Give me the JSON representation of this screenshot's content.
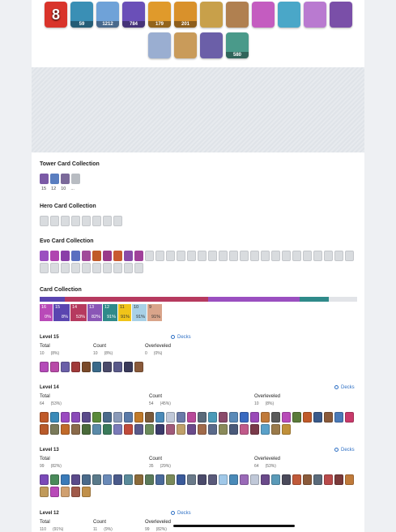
{
  "badges": [
    {
      "value": "8",
      "color": "#d9342b"
    },
    {
      "value": "59",
      "color": "#3a8fb5"
    },
    {
      "value": "1212",
      "color": "#6fa2d8"
    },
    {
      "value": "784",
      "color": "#6a4fb8"
    },
    {
      "value": "179",
      "color": "#e09a2b"
    },
    {
      "value": "201",
      "color": "#d9912b"
    },
    {
      "value": "",
      "color": "#c8a04a"
    },
    {
      "value": "",
      "color": "#b08050"
    },
    {
      "value": "",
      "color": "#c45cc0"
    },
    {
      "value": "",
      "color": "#4aa7c8"
    },
    {
      "value": "",
      "color": "#b97ad0"
    },
    {
      "value": "",
      "color": "#7a4fa8"
    },
    {
      "value": "",
      "color": "#9aaed1"
    },
    {
      "value": "",
      "color": "#c99b5a"
    },
    {
      "value": "",
      "color": "#6b5fa8"
    },
    {
      "value": "580",
      "color": "#4a9a8a"
    }
  ],
  "tower": {
    "title": "Tower Card Collection",
    "counts": [
      "15",
      "12",
      "10",
      "..."
    ],
    "colors": [
      "#7b5aa6",
      "#5a7ec0",
      "#7b6a9a",
      "#b8bcc2"
    ]
  },
  "hero": {
    "title": "Hero Card Collection",
    "count": 8
  },
  "evo": {
    "title": "Evo Card Collection",
    "colors": [
      "#9b4fc0",
      "#b045b0",
      "#8a3fa8",
      "#5a6fc0",
      "#a04a9a",
      "#c05a2a",
      "#9a3a8a",
      "#c85a30",
      "#8a4aa8",
      "#a0409a"
    ],
    "grey_count": 30
  },
  "card_collection": {
    "title": "Card Collection",
    "bar": [
      {
        "color": "#5a45b0",
        "pct": 8
      },
      {
        "color": "#b63a5f",
        "pct": 45
      },
      {
        "color": "#9a4fc0",
        "pct": 29
      },
      {
        "color": "#2f8a8a",
        "pct": 9
      },
      {
        "color": "#e2e4e8",
        "pct": 9
      }
    ],
    "levels": [
      {
        "count": "16",
        "pct": "0%",
        "color": "#b94ab8",
        "w": 16
      },
      {
        "count": "15",
        "pct": "8%",
        "color": "#5a45b0",
        "w": 20
      },
      {
        "count": "14",
        "pct": "53%",
        "color": "#b63a5f",
        "w": 20
      },
      {
        "count": "13",
        "pct": "82%",
        "color": "#8a56b6",
        "w": 18
      },
      {
        "count": "12",
        "pct": "91%",
        "color": "#2f8a8a",
        "w": 18
      },
      {
        "count": "11",
        "pct": "91%",
        "color": "#f0c419",
        "w": 16
      },
      {
        "count": "10",
        "pct": "91%",
        "color": "#a8d0e6",
        "w": 18
      },
      {
        "count": "9",
        "pct": "91%",
        "color": "#d9a48a",
        "w": 18
      }
    ]
  },
  "levels": [
    {
      "title": "Level 15",
      "total_label": "Total",
      "count_label": "Count",
      "over_label": "Overleveled",
      "total": "10",
      "total_pct": "(8%)",
      "count": "10",
      "count_pct": "(8%)",
      "over": "0",
      "over_pct": "(0%)",
      "decks": "Decks",
      "cards": [
        "#b44ab8",
        "#b84aa8",
        "#6b5fa8",
        "#a03a3a",
        "#7a4a2a",
        "#3a6a8a",
        "#4a4a6a",
        "#5a5a8a",
        "#3a3a5a",
        "#8a5a3a"
      ]
    },
    {
      "title": "Level 14",
      "total_label": "Total",
      "count_label": "Count",
      "over_label": "Overleveled",
      "total": "64",
      "total_pct": "(53%)",
      "count": "54",
      "count_pct": "(45%)",
      "over": "10",
      "over_pct": "(8%)",
      "decks": "Decks",
      "cards": [
        "#c05a2a",
        "#3a8ab8",
        "#9a4ac0",
        "#8a4ab8",
        "#5a4a8a",
        "#5a8a3a",
        "#4a6a8a",
        "#8a9ab8",
        "#5a7aa8",
        "#c07a2a",
        "#7a5a3a",
        "#4a8ab8",
        "#c0c8d8",
        "#6a7aa8",
        "#b84a9a",
        "#5a6a7a",
        "#4a9ab8",
        "#8a4a6a",
        "#5a8ab8",
        "#3a6ac0",
        "#9a4ab8",
        "#c07a3a",
        "#5a5a5a",
        "#b84ab8",
        "#5a7a3a",
        "#c05a2a",
        "#3a5a8a",
        "#8a5a3a",
        "#4a7ab8",
        "#c83a6a",
        "#b85a2a",
        "#7a7a5a",
        "#c06a2a",
        "#8a6a4a",
        "#4a6a3a",
        "#5a8aa8",
        "#3a7a5a",
        "#7a7ab8",
        "#c04a3a",
        "#5a5a8a",
        "#6a8a5a",
        "#3a3a6a",
        "#a05a7a",
        "#c0a06a",
        "#6a4a8a",
        "#a06a4a",
        "#5a6a8a",
        "#8a8a5a",
        "#4a5a7a",
        "#c05a8a",
        "#7a3a4a",
        "#5aa0c8",
        "#9a7a4a",
        "#c0903a"
      ]
    },
    {
      "title": "Level 13",
      "total_label": "Total",
      "count_label": "Count",
      "over_label": "Overleveled",
      "total": "99",
      "total_pct": "(82%)",
      "count": "35",
      "count_pct": "(29%)",
      "over": "64",
      "over_pct": "(53%)",
      "decks": "Decks",
      "cards": [
        "#7a4ab8",
        "#4a8a5a",
        "#3a7ab8",
        "#5a4a8a",
        "#4a6a8a",
        "#5a7a8a",
        "#6a8ab8",
        "#4a5a8a",
        "#5a8a9a",
        "#8a6a3a",
        "#5a7a5a",
        "#4a6a9a",
        "#7a8a5a",
        "#3a5a9a",
        "#6a7a8a",
        "#4a4a6a",
        "#5a5a7a",
        "#a0c8e8",
        "#4a8ab8",
        "#9a6ab8",
        "#c0c8d8",
        "#6a4a8a",
        "#5a9ab8",
        "#4a4a5a",
        "#c05a3a",
        "#8a5a3a",
        "#5a6a7a",
        "#b84a4a",
        "#7a3a3a",
        "#c07a3a",
        "#c09a5a",
        "#b84ab8",
        "#d0a070",
        "#a05a4a",
        "#c0904a"
      ]
    },
    {
      "title": "Level 12",
      "total_label": "Total",
      "count_label": "Count",
      "over_label": "Overleveled",
      "total": "110",
      "total_pct": "(91%)",
      "count": "11",
      "count_pct": "(9%)",
      "over": "99",
      "over_pct": "(82%)",
      "decks": "Decks",
      "cards": []
    }
  ]
}
